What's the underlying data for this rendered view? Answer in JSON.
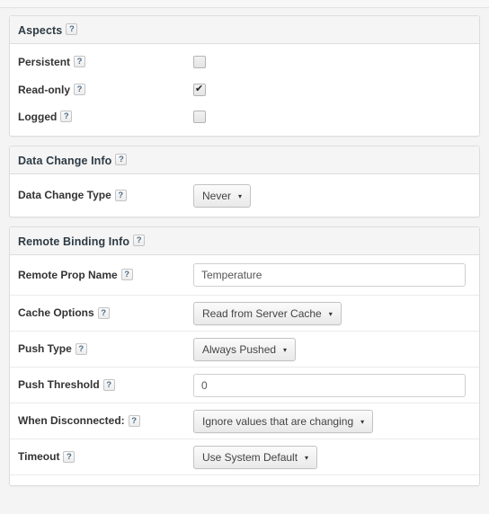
{
  "sections": [
    {
      "id": "aspects",
      "title": "Aspects",
      "help": "?",
      "rows": [
        {
          "label": "Persistent",
          "help": "?",
          "control": "checkbox",
          "checked": false
        },
        {
          "label": "Read-only",
          "help": "?",
          "control": "checkbox",
          "checked": true
        },
        {
          "label": "Logged",
          "help": "?",
          "control": "checkbox",
          "checked": false
        }
      ]
    },
    {
      "id": "data-change-info",
      "title": "Data Change Info",
      "help": "?",
      "rows": [
        {
          "label": "Data Change Type",
          "help": "?",
          "control": "dropdown",
          "value": "Never"
        }
      ]
    },
    {
      "id": "remote-binding-info",
      "title": "Remote Binding Info",
      "help": "?",
      "rows": [
        {
          "label": "Remote Prop Name",
          "help": "?",
          "control": "text",
          "value": "Temperature"
        },
        {
          "label": "Cache Options",
          "help": "?",
          "control": "dropdown",
          "value": "Read from Server Cache"
        },
        {
          "label": "Push Type",
          "help": "?",
          "control": "dropdown",
          "value": "Always Pushed"
        },
        {
          "label": "Push Threshold",
          "help": "?",
          "control": "text",
          "value": "0"
        },
        {
          "label": "When Disconnected:",
          "help": "?",
          "control": "dropdown",
          "value": "Ignore values that are changing"
        },
        {
          "label": "Timeout",
          "help": "?",
          "control": "dropdown",
          "value": "Use System Default"
        }
      ]
    }
  ],
  "icons": {
    "help_badge": "question-mark-badge",
    "caret": "▾",
    "check": "✔"
  },
  "colors": {
    "page_background": "#f4f4f4",
    "panel_background": "#ffffff",
    "panel_border": "#dddddd",
    "header_background": "#f5f5f5",
    "title_text": "#2e3b45",
    "label_text": "#333333",
    "help_text": "#4a6a86",
    "input_border": "#cfcfcf",
    "divider": "#ebebeb"
  }
}
